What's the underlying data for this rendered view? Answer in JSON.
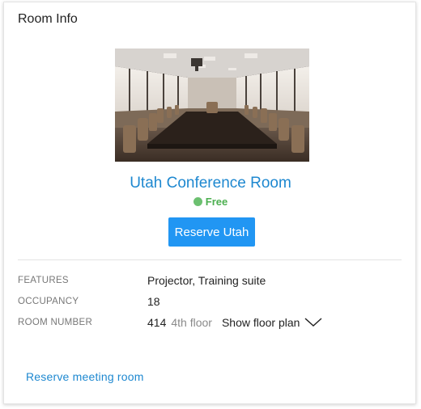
{
  "panel": {
    "title": "Room Info"
  },
  "room": {
    "name": "Utah Conference Room",
    "status": "Free",
    "reserve_label": "Reserve Utah",
    "photo_alt": "Utah Conference Room"
  },
  "details": {
    "features_label": "FEATURES",
    "features_value": "Projector, Training suite",
    "occupancy_label": "OCCUPANCY",
    "occupancy_value": "18",
    "room_number_label": "ROOM NUMBER",
    "room_number_value": "414",
    "floor": "4th floor",
    "floor_plan_label": "Show floor plan"
  },
  "footer": {
    "reserve_link": "Reserve meeting room"
  },
  "colors": {
    "accent": "#2196f3",
    "link": "#1e88d0",
    "status_free": "#4caf50"
  },
  "icons": {
    "status": "status-dot-icon",
    "floor_plan": "chevron-down-icon"
  }
}
